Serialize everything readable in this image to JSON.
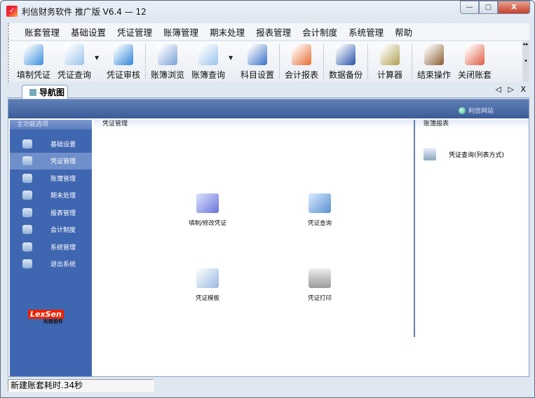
{
  "window": {
    "title": "利信财务软件 推广版 V6.4 — 12",
    "min": "—",
    "max": "▢",
    "close": "X"
  },
  "menu": [
    "账套管理",
    "基础设置",
    "凭证管理",
    "账簿管理",
    "期末处理",
    "报表管理",
    "会计制度",
    "系统管理",
    "帮助"
  ],
  "toolbar": [
    {
      "label": "填制凭证",
      "icon": "voucher-fill-icon",
      "color": "#3a8ee0",
      "dropdown": false
    },
    {
      "label": "凭证查询",
      "icon": "voucher-search-icon",
      "color": "#9bc3ec",
      "dropdown": true
    },
    {
      "label": "凭证审核",
      "icon": "gear-audit-icon",
      "color": "#2a84d8",
      "dropdown": false,
      "sep": true
    },
    {
      "label": "账簿浏览",
      "icon": "ledger-browse-icon",
      "color": "#7aa0d8",
      "dropdown": false
    },
    {
      "label": "账簿查询",
      "icon": "ledger-search-icon",
      "color": "#9bc3ec",
      "dropdown": true
    },
    {
      "label": "科目设置",
      "icon": "account-settings-icon",
      "color": "#3570c8",
      "dropdown": false,
      "sep": true
    },
    {
      "label": "会计报表",
      "icon": "report-chart-icon",
      "color": "#e86a30",
      "dropdown": false,
      "sep": true
    },
    {
      "label": "数据备份",
      "icon": "floppy-backup-icon",
      "color": "#2650a8",
      "dropdown": false,
      "sep": true
    },
    {
      "label": "计算器",
      "icon": "calculator-icon",
      "color": "#b0a050",
      "dropdown": false,
      "sep": true
    },
    {
      "label": "结束操作",
      "icon": "coffee-cup-icon",
      "color": "#8a5a30",
      "dropdown": false
    },
    {
      "label": "关闭账套",
      "icon": "folder-close-icon",
      "color": "#e05a40",
      "dropdown": false
    }
  ],
  "tab": {
    "label": "导航图",
    "nav": "◁ ▷ X"
  },
  "header": {
    "site_link": "利信网站"
  },
  "sidebar": {
    "title": "主功能选项",
    "items": [
      "基础设置",
      "凭证管理",
      "账簿管理",
      "期末处理",
      "报表管理",
      "会计制度",
      "系统管理",
      "退出系统"
    ],
    "active": 1,
    "logo_text": "LexSen",
    "logo_sub": "利信软件"
  },
  "main": {
    "title": "凭证管理",
    "items": [
      "填制/修改凭证",
      "凭证查询",
      "凭证模板",
      "凭证打印"
    ]
  },
  "right": {
    "title": "账簿报表",
    "items": [
      "凭证查询(列表方式)"
    ]
  },
  "status": {
    "text": "新建账套耗时.34秒"
  }
}
